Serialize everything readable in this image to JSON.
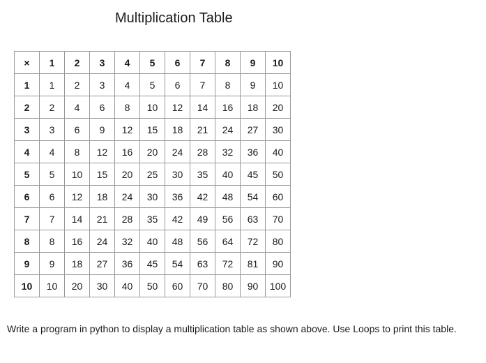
{
  "title": "Multiplication Table",
  "corner_symbol": "×",
  "size": 10,
  "chart_data": {
    "type": "table",
    "title": "Multiplication Table",
    "col_headers": [
      1,
      2,
      3,
      4,
      5,
      6,
      7,
      8,
      9,
      10
    ],
    "row_headers": [
      1,
      2,
      3,
      4,
      5,
      6,
      7,
      8,
      9,
      10
    ],
    "values": [
      [
        1,
        2,
        3,
        4,
        5,
        6,
        7,
        8,
        9,
        10
      ],
      [
        2,
        4,
        6,
        8,
        10,
        12,
        14,
        16,
        18,
        20
      ],
      [
        3,
        6,
        9,
        12,
        15,
        18,
        21,
        24,
        27,
        30
      ],
      [
        4,
        8,
        12,
        16,
        20,
        24,
        28,
        32,
        36,
        40
      ],
      [
        5,
        10,
        15,
        20,
        25,
        30,
        35,
        40,
        45,
        50
      ],
      [
        6,
        12,
        18,
        24,
        30,
        36,
        42,
        48,
        54,
        60
      ],
      [
        7,
        14,
        21,
        28,
        35,
        42,
        49,
        56,
        63,
        70
      ],
      [
        8,
        16,
        24,
        32,
        40,
        48,
        56,
        64,
        72,
        80
      ],
      [
        9,
        18,
        27,
        36,
        45,
        54,
        63,
        72,
        81,
        90
      ],
      [
        10,
        20,
        30,
        40,
        50,
        60,
        70,
        80,
        90,
        100
      ]
    ]
  },
  "instruction": "Write a program in python to display a multiplication table as shown above.  Use Loops to print this table."
}
